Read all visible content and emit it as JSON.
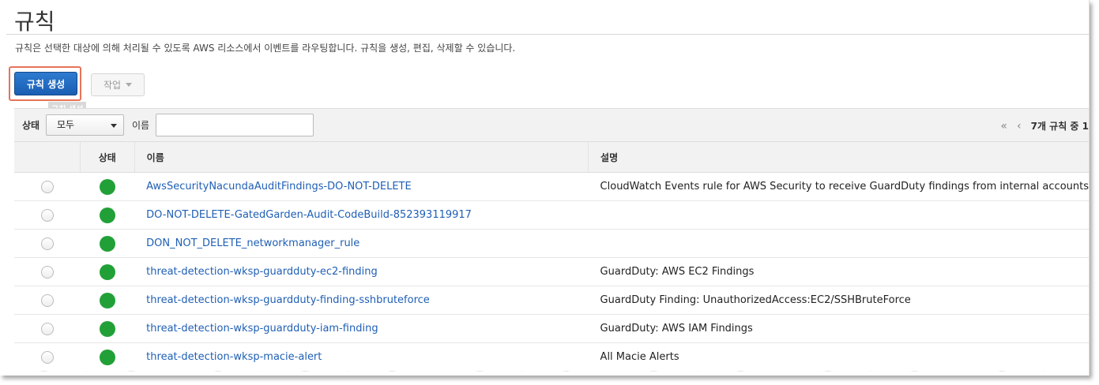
{
  "page": {
    "title": "규칙",
    "description": "규칙은 선택한 대상에 의해 처리될 수 있도록 AWS 리소스에서 이벤트를 라우팅합니다. 규칙을 생성, 편집, 삭제할 수 있습니다."
  },
  "buttons": {
    "create_rule": "규칙 생성",
    "tooltip": "규칙 생성",
    "actions": "작업"
  },
  "filter": {
    "status_label": "상태",
    "status_value": "모두",
    "name_label": "이름",
    "name_value": ""
  },
  "pager": {
    "first_icon": "«",
    "prev_icon": "‹",
    "count_text": "7개 규칙 중 1"
  },
  "table": {
    "headers": {
      "status": "상태",
      "name": "이름",
      "description": "설명"
    },
    "rows": [
      {
        "status": "enabled",
        "name": "AwsSecurityNacundaAuditFindings-DO-NOT-DELETE",
        "description": "CloudWatch Events rule for AWS Security to receive GuardDuty findings from internal accounts"
      },
      {
        "status": "enabled",
        "name": "DO-NOT-DELETE-GatedGarden-Audit-CodeBuild-852393119917",
        "description": ""
      },
      {
        "status": "enabled",
        "name": "DON_NOT_DELETE_networkmanager_rule",
        "description": ""
      },
      {
        "status": "enabled",
        "name": "threat-detection-wksp-guardduty-ec2-finding",
        "description": "GuardDuty: AWS EC2 Findings"
      },
      {
        "status": "enabled",
        "name": "threat-detection-wksp-guardduty-finding-sshbruteforce",
        "description": "GuardDuty Finding: UnauthorizedAccess:EC2/SSHBruteForce"
      },
      {
        "status": "enabled",
        "name": "threat-detection-wksp-guardduty-iam-finding",
        "description": "GuardDuty: AWS IAM Findings"
      },
      {
        "status": "enabled",
        "name": "threat-detection-wksp-macie-alert",
        "description": "All Macie Alerts"
      }
    ]
  },
  "colors": {
    "primary_button": "#1a5fb4",
    "highlight_border": "#e8735a",
    "status_enabled": "#22a038",
    "link": "#1f5fb5"
  }
}
